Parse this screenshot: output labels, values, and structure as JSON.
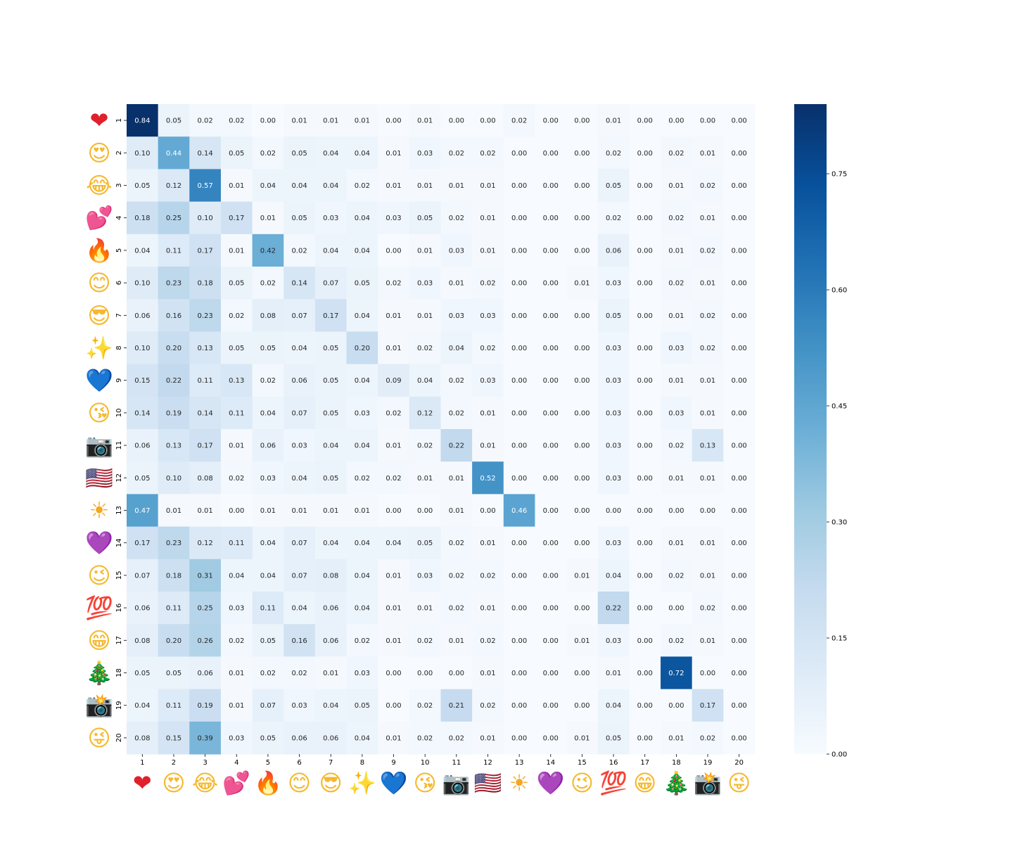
{
  "chart_data": {
    "type": "heatmap",
    "title": "",
    "xlabel": "",
    "ylabel": "",
    "x_labels": [
      "1",
      "2",
      "3",
      "4",
      "5",
      "6",
      "7",
      "8",
      "9",
      "10",
      "11",
      "12",
      "13",
      "14",
      "15",
      "16",
      "17",
      "18",
      "19",
      "20"
    ],
    "y_labels": [
      "1",
      "2",
      "3",
      "4",
      "5",
      "6",
      "7",
      "8",
      "9",
      "10",
      "11",
      "12",
      "13",
      "14",
      "15",
      "16",
      "17",
      "18",
      "19",
      "20"
    ],
    "category_icons": [
      {
        "name": "red-heart-icon",
        "glyph": "❤",
        "color": "#e0202a"
      },
      {
        "name": "heart-eyes-face-icon",
        "glyph": "😍",
        "color": "#f5b82e"
      },
      {
        "name": "tears-of-joy-face-icon",
        "glyph": "😂",
        "color": "#f5b82e"
      },
      {
        "name": "two-hearts-icon",
        "glyph": "💕",
        "color": "#f0479a"
      },
      {
        "name": "fire-icon",
        "glyph": "🔥",
        "color": "#f26522"
      },
      {
        "name": "smiling-face-icon",
        "glyph": "😊",
        "color": "#f5b82e"
      },
      {
        "name": "sunglasses-face-icon",
        "glyph": "😎",
        "color": "#f5b82e"
      },
      {
        "name": "sparkles-icon",
        "glyph": "✨",
        "color": "#f7c948"
      },
      {
        "name": "blue-heart-icon",
        "glyph": "💙",
        "color": "#1e7be0"
      },
      {
        "name": "kissing-face-icon",
        "glyph": "😘",
        "color": "#f5b82e"
      },
      {
        "name": "camera-icon",
        "glyph": "📷",
        "color": "#555555"
      },
      {
        "name": "us-flag-icon",
        "glyph": "🇺🇸",
        "color": "#3c3b6e"
      },
      {
        "name": "sun-icon",
        "glyph": "☀",
        "color": "#f5a623"
      },
      {
        "name": "purple-heart-icon",
        "glyph": "💜",
        "color": "#9b3fd6"
      },
      {
        "name": "winking-face-icon",
        "glyph": "😉",
        "color": "#f5b82e"
      },
      {
        "name": "hundred-points-icon",
        "glyph": "💯",
        "color": "#e0202a"
      },
      {
        "name": "grinning-face-icon",
        "glyph": "😁",
        "color": "#f5b82e"
      },
      {
        "name": "christmas-tree-icon",
        "glyph": "🎄",
        "color": "#2e8b3a"
      },
      {
        "name": "camera-flash-icon",
        "glyph": "📸",
        "color": "#555555"
      },
      {
        "name": "winking-tongue-face-icon",
        "glyph": "😜",
        "color": "#f5b82e"
      }
    ],
    "values": [
      [
        0.84,
        0.05,
        0.02,
        0.02,
        0.0,
        0.01,
        0.01,
        0.01,
        0.0,
        0.01,
        0.0,
        0.0,
        0.02,
        0.0,
        0.0,
        0.01,
        0.0,
        0.0,
        0.0,
        0.0
      ],
      [
        0.1,
        0.44,
        0.14,
        0.05,
        0.02,
        0.05,
        0.04,
        0.04,
        0.01,
        0.03,
        0.02,
        0.02,
        0.0,
        0.0,
        0.0,
        0.02,
        0.0,
        0.02,
        0.01,
        0.0
      ],
      [
        0.05,
        0.12,
        0.57,
        0.01,
        0.04,
        0.04,
        0.04,
        0.02,
        0.01,
        0.01,
        0.01,
        0.01,
        0.0,
        0.0,
        0.0,
        0.05,
        0.0,
        0.01,
        0.02,
        0.0
      ],
      [
        0.18,
        0.25,
        0.1,
        0.17,
        0.01,
        0.05,
        0.03,
        0.04,
        0.03,
        0.05,
        0.02,
        0.01,
        0.0,
        0.0,
        0.0,
        0.02,
        0.0,
        0.02,
        0.01,
        0.0
      ],
      [
        0.04,
        0.11,
        0.17,
        0.01,
        0.42,
        0.02,
        0.04,
        0.04,
        0.0,
        0.01,
        0.03,
        0.01,
        0.0,
        0.0,
        0.0,
        0.06,
        0.0,
        0.01,
        0.02,
        0.0
      ],
      [
        0.1,
        0.23,
        0.18,
        0.05,
        0.02,
        0.14,
        0.07,
        0.05,
        0.02,
        0.03,
        0.01,
        0.02,
        0.0,
        0.0,
        0.01,
        0.03,
        0.0,
        0.02,
        0.01,
        0.0
      ],
      [
        0.06,
        0.16,
        0.23,
        0.02,
        0.08,
        0.07,
        0.17,
        0.04,
        0.01,
        0.01,
        0.03,
        0.03,
        0.0,
        0.0,
        0.0,
        0.05,
        0.0,
        0.01,
        0.02,
        0.0
      ],
      [
        0.1,
        0.2,
        0.13,
        0.05,
        0.05,
        0.04,
        0.05,
        0.2,
        0.01,
        0.02,
        0.04,
        0.02,
        0.0,
        0.0,
        0.0,
        0.03,
        0.0,
        0.03,
        0.02,
        0.0
      ],
      [
        0.15,
        0.22,
        0.11,
        0.13,
        0.02,
        0.06,
        0.05,
        0.04,
        0.09,
        0.04,
        0.02,
        0.03,
        0.0,
        0.0,
        0.0,
        0.03,
        0.0,
        0.01,
        0.01,
        0.0
      ],
      [
        0.14,
        0.19,
        0.14,
        0.11,
        0.04,
        0.07,
        0.05,
        0.03,
        0.02,
        0.12,
        0.02,
        0.01,
        0.0,
        0.0,
        0.0,
        0.03,
        0.0,
        0.03,
        0.01,
        0.0
      ],
      [
        0.06,
        0.13,
        0.17,
        0.01,
        0.06,
        0.03,
        0.04,
        0.04,
        0.01,
        0.02,
        0.22,
        0.01,
        0.0,
        0.0,
        0.0,
        0.03,
        0.0,
        0.02,
        0.13,
        0.0
      ],
      [
        0.05,
        0.1,
        0.08,
        0.02,
        0.03,
        0.04,
        0.05,
        0.02,
        0.02,
        0.01,
        0.01,
        0.52,
        0.0,
        0.0,
        0.0,
        0.03,
        0.0,
        0.01,
        0.01,
        0.0
      ],
      [
        0.47,
        0.01,
        0.01,
        0.0,
        0.01,
        0.01,
        0.01,
        0.01,
        0.0,
        0.0,
        0.01,
        0.0,
        0.46,
        0.0,
        0.0,
        0.0,
        0.0,
        0.0,
        0.0,
        0.0
      ],
      [
        0.17,
        0.23,
        0.12,
        0.11,
        0.04,
        0.07,
        0.04,
        0.04,
        0.04,
        0.05,
        0.02,
        0.01,
        0.0,
        0.0,
        0.0,
        0.03,
        0.0,
        0.01,
        0.01,
        0.0
      ],
      [
        0.07,
        0.18,
        0.31,
        0.04,
        0.04,
        0.07,
        0.08,
        0.04,
        0.01,
        0.03,
        0.02,
        0.02,
        0.0,
        0.0,
        0.01,
        0.04,
        0.0,
        0.02,
        0.01,
        0.0
      ],
      [
        0.06,
        0.11,
        0.25,
        0.03,
        0.11,
        0.04,
        0.06,
        0.04,
        0.01,
        0.01,
        0.02,
        0.01,
        0.0,
        0.0,
        0.0,
        0.22,
        0.0,
        0.0,
        0.02,
        0.0
      ],
      [
        0.08,
        0.2,
        0.26,
        0.02,
        0.05,
        0.16,
        0.06,
        0.02,
        0.01,
        0.02,
        0.01,
        0.02,
        0.0,
        0.0,
        0.01,
        0.03,
        0.0,
        0.02,
        0.01,
        0.0
      ],
      [
        0.05,
        0.05,
        0.06,
        0.01,
        0.02,
        0.02,
        0.01,
        0.03,
        0.0,
        0.0,
        0.0,
        0.01,
        0.0,
        0.0,
        0.0,
        0.01,
        0.0,
        0.72,
        0.0,
        0.0
      ],
      [
        0.04,
        0.11,
        0.19,
        0.01,
        0.07,
        0.03,
        0.04,
        0.05,
        0.0,
        0.02,
        0.21,
        0.02,
        0.0,
        0.0,
        0.0,
        0.04,
        0.0,
        0.0,
        0.17,
        0.0
      ],
      [
        0.08,
        0.15,
        0.39,
        0.03,
        0.05,
        0.06,
        0.06,
        0.04,
        0.01,
        0.02,
        0.02,
        0.01,
        0.0,
        0.0,
        0.01,
        0.05,
        0.0,
        0.01,
        0.02,
        0.0
      ]
    ],
    "value_format": "0.00",
    "colorbar": {
      "min": 0.0,
      "max": 0.84,
      "ticks": [
        0.0,
        0.15,
        0.3,
        0.45,
        0.6,
        0.75
      ],
      "tick_labels": [
        "0.00",
        "0.15",
        "0.30",
        "0.45",
        "0.60",
        "0.75"
      ],
      "colormap": "Blues",
      "stops": [
        "#f7fbff",
        "#deebf7",
        "#c6dbef",
        "#9ecae1",
        "#6baed6",
        "#4292c6",
        "#2171b5",
        "#08519c",
        "#08306b"
      ]
    },
    "grid": false,
    "legend": "colorbar-right"
  }
}
